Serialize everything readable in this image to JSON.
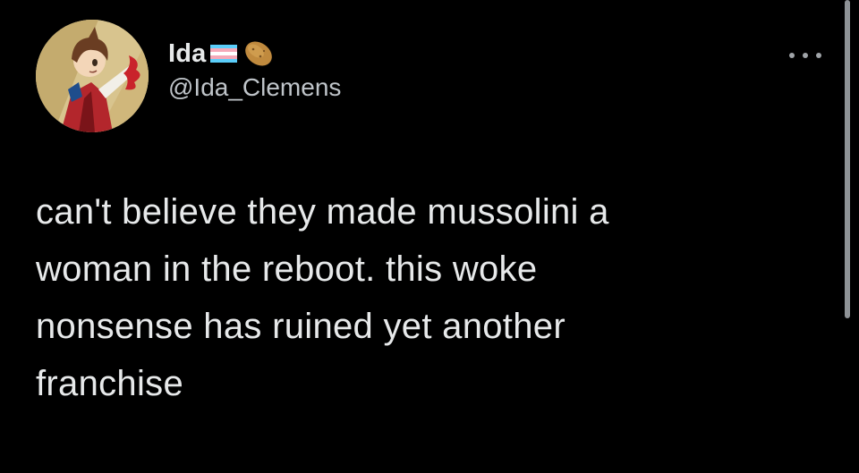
{
  "author": {
    "display_name": "Ida",
    "name_emojis": [
      "transgender-flag-emoji",
      "potato-emoji"
    ],
    "handle": "@Ida_Clemens",
    "avatar": "anime-character-avatar"
  },
  "tweet": {
    "lines": [
      "can't believe they made mussolini a",
      "woman in the reboot. this woke",
      "nonsense has ruined yet another",
      "franchise"
    ]
  },
  "menu": {
    "icon": "more-options-icon"
  },
  "colors": {
    "background": "#000000",
    "text": "#e7e9ea",
    "secondary_text": "#bfc4c9",
    "flag_blue": "#5bcefa",
    "flag_pink": "#f5a9b8",
    "flag_white": "#ffffff"
  }
}
